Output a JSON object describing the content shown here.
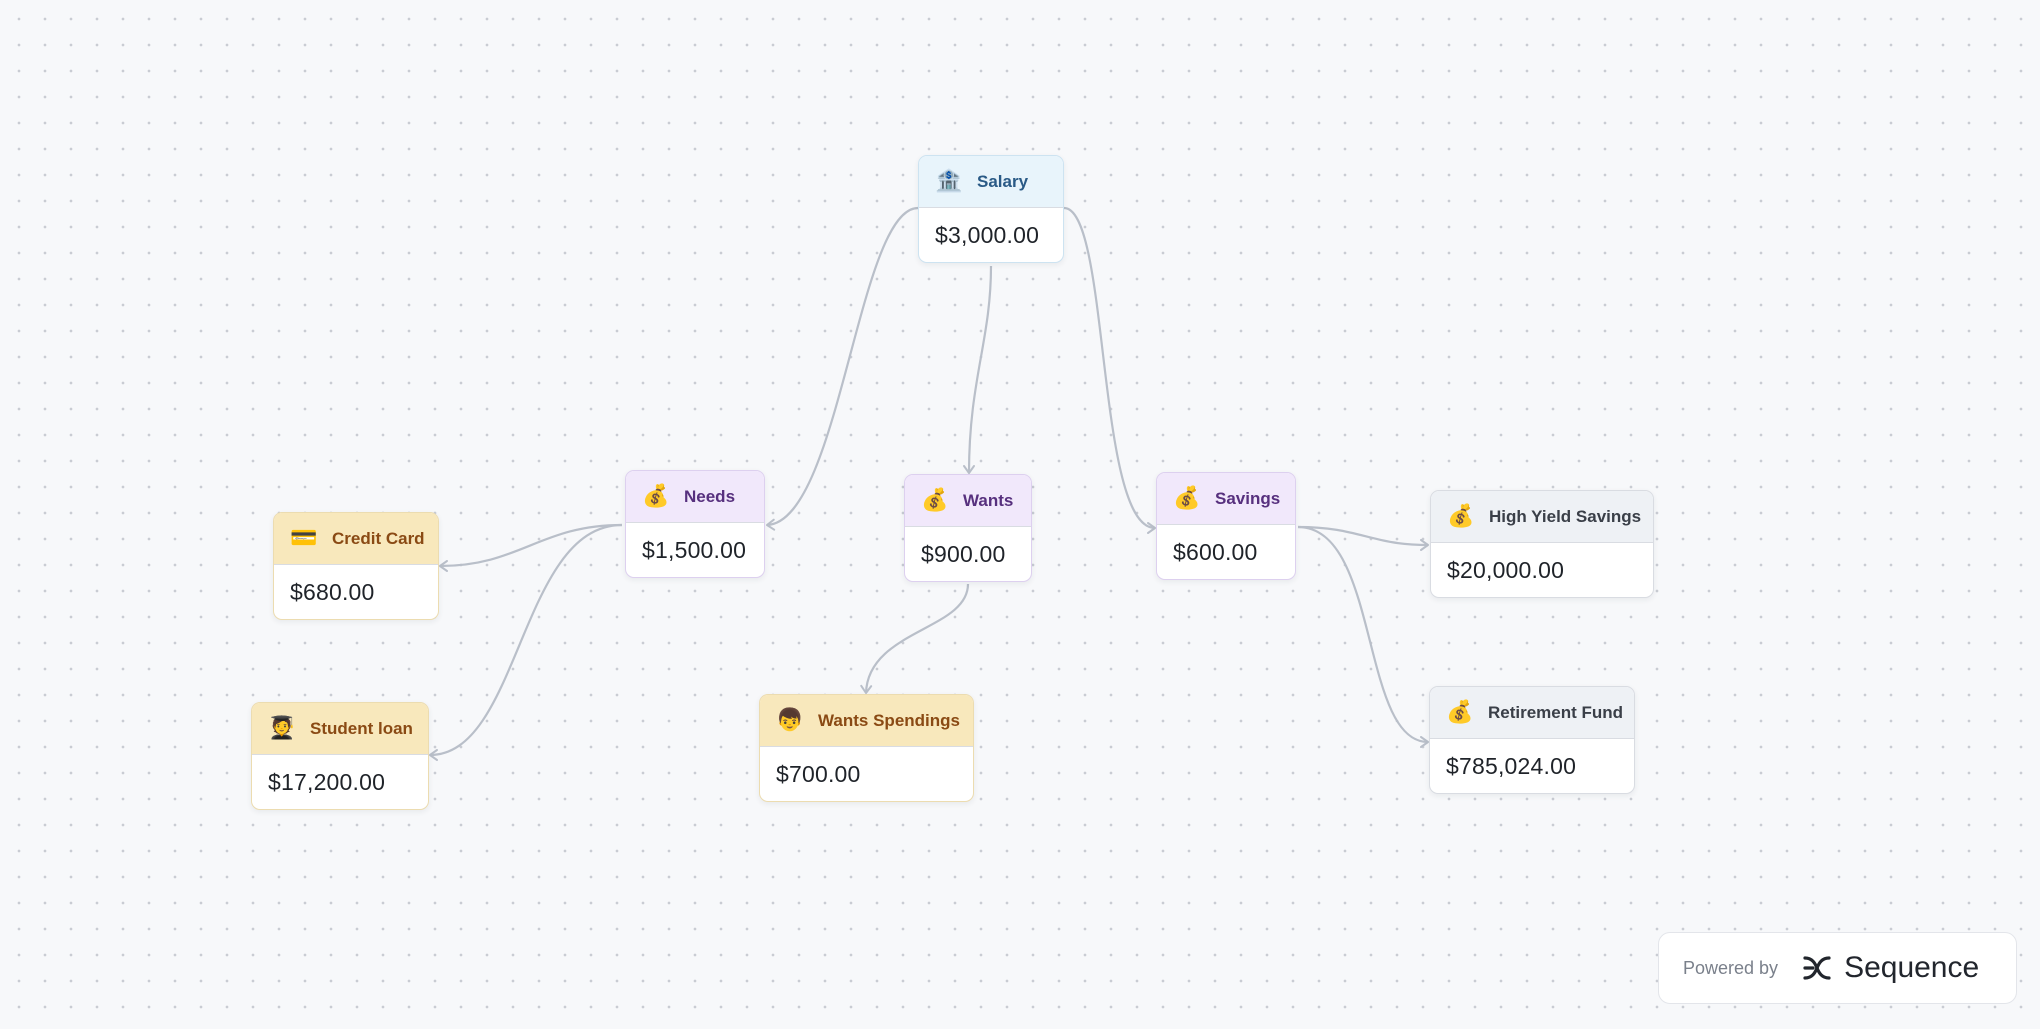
{
  "nodes": {
    "salary": {
      "label": "Salary",
      "amount": "$3,000.00",
      "icon": "bank-icon",
      "glyph": "🏦",
      "color": "#e8f4fb"
    },
    "needs": {
      "label": "Needs",
      "amount": "$1,500.00",
      "icon": "money-bag-icon",
      "glyph": "💰",
      "color": "#f1e8fb"
    },
    "wants": {
      "label": "Wants",
      "amount": "$900.00",
      "icon": "money-bag-icon",
      "glyph": "💰",
      "color": "#f1e8fb"
    },
    "savings": {
      "label": "Savings",
      "amount": "$600.00",
      "icon": "money-bag-icon",
      "glyph": "💰",
      "color": "#f1e8fb"
    },
    "credit_card": {
      "label": "Credit Card",
      "amount": "$680.00",
      "icon": "credit-card-icon",
      "glyph": "💳",
      "color": "#f8e8bc"
    },
    "student_loan": {
      "label": "Student loan",
      "amount": "$17,200.00",
      "icon": "student-icon",
      "glyph": "🧑‍🎓",
      "color": "#f8e8bc"
    },
    "wants_spendings": {
      "label": "Wants Spendings",
      "amount": "$700.00",
      "icon": "person-icon",
      "glyph": "👦",
      "color": "#f8e8bc"
    },
    "high_yield": {
      "label": "High Yield Savings",
      "amount": "$20,000.00",
      "icon": "money-bag-icon",
      "glyph": "💰",
      "color": "#eef1f5"
    },
    "retirement": {
      "label": "Retirement Fund",
      "amount": "$785,024.00",
      "icon": "money-bag-icon",
      "glyph": "💰",
      "color": "#eef1f5"
    }
  },
  "edges": [
    {
      "from": "salary",
      "to": "needs"
    },
    {
      "from": "salary",
      "to": "wants"
    },
    {
      "from": "salary",
      "to": "savings"
    },
    {
      "from": "needs",
      "to": "credit_card"
    },
    {
      "from": "needs",
      "to": "student_loan"
    },
    {
      "from": "wants",
      "to": "wants_spendings"
    },
    {
      "from": "savings",
      "to": "high_yield"
    },
    {
      "from": "savings",
      "to": "retirement"
    }
  ],
  "footer": {
    "powered_by": "Powered by",
    "brand": "Sequence",
    "logo_icon": "sequence-logo-icon"
  },
  "colors": {
    "edge": "#b9bfc9",
    "background": "#f7f8fa",
    "dot": "#c9ccd3"
  }
}
